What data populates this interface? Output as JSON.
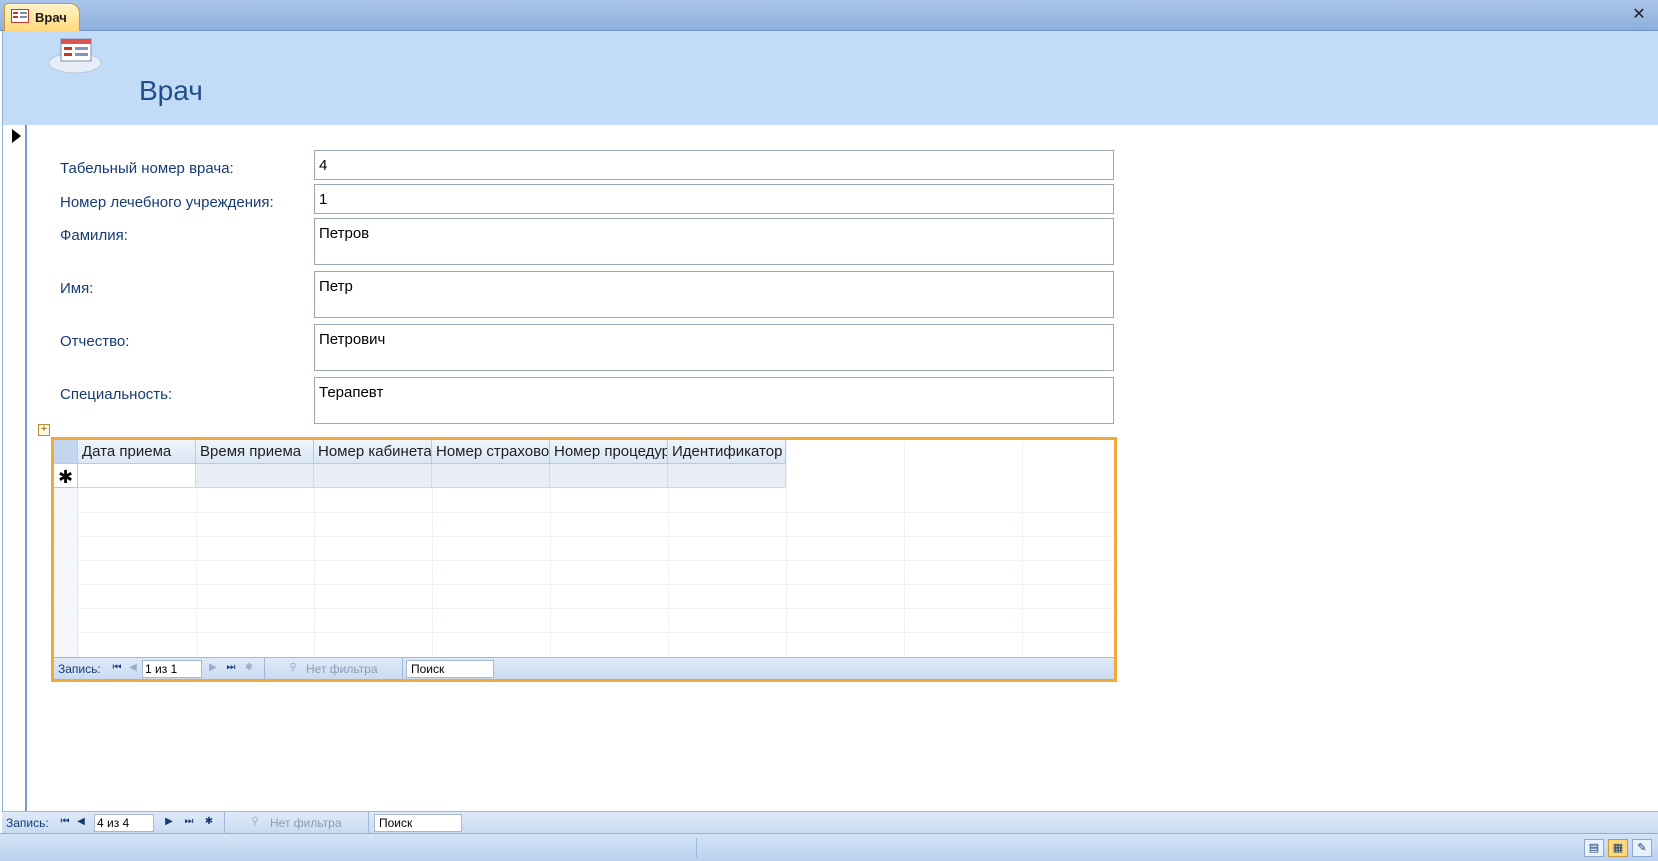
{
  "window": {
    "tab_title": "Врач",
    "header_title": "Врач"
  },
  "form": {
    "fields": [
      {
        "label": "Табельный номер врача:",
        "value": "4"
      },
      {
        "label": "Номер лечебного учреждения:",
        "value": "1"
      },
      {
        "label": "Фамилия:",
        "value": "Петров"
      },
      {
        "label": "Имя:",
        "value": "Петр"
      },
      {
        "label": "Отчество:",
        "value": "Петрович"
      },
      {
        "label": "Специальность:",
        "value": "Терапевт"
      }
    ]
  },
  "subform": {
    "columns": [
      "Дата приема",
      "Время приема",
      "Номер кабинета",
      "Номер страхового",
      "Номер процедуры",
      "Идентификатор"
    ],
    "new_row_marker": "✱",
    "nav": {
      "label": "Запись:",
      "counter": "1 из 1",
      "filter": "Нет фильтра",
      "search": "Поиск"
    }
  },
  "main_nav": {
    "label": "Запись:",
    "counter": "4 из 4",
    "filter": "Нет фильтра",
    "search": "Поиск"
  },
  "icons": {
    "close": "close-icon",
    "form": "form-icon",
    "record_pointer": "record-pointer-icon"
  }
}
